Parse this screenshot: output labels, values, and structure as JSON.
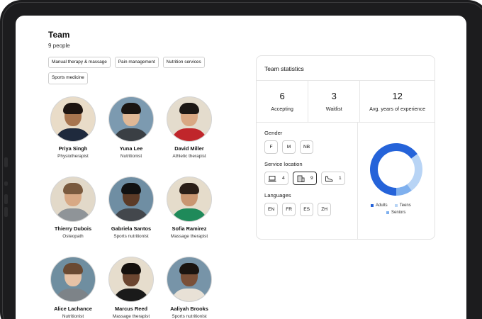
{
  "team": {
    "title": "Team",
    "count": "9 people",
    "tags": [
      "Manual therapy & massage",
      "Pain management",
      "Nutrition services",
      "Sports medicine"
    ]
  },
  "people": [
    {
      "name": "Priya Singh",
      "role": "Physiotherapist",
      "bg": "#e9dcc8",
      "skin": "#a8754f",
      "hair": "#1d1410",
      "shirt": "#1f2a3d"
    },
    {
      "name": "Yuna Lee",
      "role": "Nutritionist",
      "bg": "#7c9ab0",
      "skin": "#e0b896",
      "hair": "#1a1512",
      "shirt": "#3a3f44"
    },
    {
      "name": "David Miller",
      "role": "Athletic therapist",
      "bg": "#e4dccd",
      "skin": "#d9a883",
      "hair": "#1c1714",
      "shirt": "#c0262b"
    },
    {
      "name": "Thierry Dubois",
      "role": "Osteopath",
      "bg": "#e2d9c9",
      "skin": "#d8a985",
      "hair": "#7a5a3e",
      "shirt": "#8f9498"
    },
    {
      "name": "Gabriela Santos",
      "role": "Sports nutritionist",
      "bg": "#6f8ea3",
      "skin": "#5c3b27",
      "hair": "#111",
      "shirt": "#43474c"
    },
    {
      "name": "Sofia Ramirez",
      "role": "Massage therapist",
      "bg": "#e5dccb",
      "skin": "#c99671",
      "hair": "#2a1e17",
      "shirt": "#1f8a5a"
    },
    {
      "name": "Alice Lachance",
      "role": "Nutritionist",
      "bg": "#6f8ea0",
      "skin": "#e6c2a6",
      "hair": "#6a4a33",
      "shirt": "#7d8388"
    },
    {
      "name": "Marcus Reed",
      "role": "Massage therapist",
      "bg": "#e6ddcd",
      "skin": "#6b4530",
      "hair": "#15100d",
      "shirt": "#1a1a1a"
    },
    {
      "name": "Aaliyah Brooks",
      "role": "Sports nutritionist",
      "bg": "#7794a8",
      "skin": "#7a5038",
      "hair": "#1a1410",
      "shirt": "#e8e1d6"
    }
  ],
  "stats": {
    "title": "Team statistics",
    "metrics": [
      {
        "value": "6",
        "label": "Accepting"
      },
      {
        "value": "3",
        "label": "Waitlist"
      },
      {
        "value": "12",
        "label": "Avg. years of experience"
      }
    ],
    "gender": {
      "label": "Gender",
      "options": [
        "F",
        "M",
        "NB"
      ]
    },
    "location": {
      "label": "Service location",
      "options": [
        {
          "icon": "laptop-icon",
          "count": "4"
        },
        {
          "icon": "building-icon",
          "count": "9",
          "selected": true
        },
        {
          "icon": "shoe-icon",
          "count": "1"
        }
      ]
    },
    "languages": {
      "label": "Languages",
      "options": [
        "EN",
        "FR",
        "ES",
        "ZH"
      ]
    }
  },
  "chart_data": {
    "type": "pie",
    "categories": [
      "Adults",
      "Teens",
      "Seniors"
    ],
    "values": [
      65,
      25,
      10
    ],
    "colors": [
      "#2563d9",
      "#b8d4f5",
      "#7fb0ee"
    ],
    "legend_position": "bottom"
  }
}
